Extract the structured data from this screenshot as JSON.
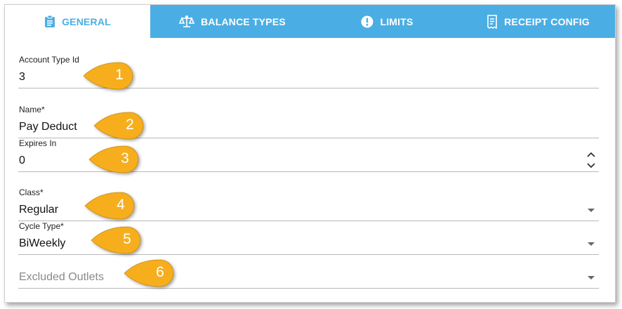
{
  "tabs": [
    {
      "label": "GENERAL",
      "icon": "clipboard-icon",
      "active": true
    },
    {
      "label": "BALANCE TYPES",
      "icon": "scale-icon",
      "active": false
    },
    {
      "label": "LIMITS",
      "icon": "exclamation-circle-icon",
      "active": false
    },
    {
      "label": "RECEIPT CONFIG",
      "icon": "receipt-icon",
      "active": false
    }
  ],
  "fields": {
    "account_type_id": {
      "label": "Account Type Id",
      "value": "3"
    },
    "name": {
      "label": "Name*",
      "value": "Pay Deduct"
    },
    "expires_in": {
      "label": "Expires In",
      "value": "0"
    },
    "class": {
      "label": "Class*",
      "value": "Regular"
    },
    "cycle_type": {
      "label": "Cycle Type*",
      "value": "BiWeekly"
    },
    "excluded_outlets": {
      "placeholder": "Excluded Outlets"
    }
  },
  "callouts": [
    "1",
    "2",
    "3",
    "4",
    "5",
    "6"
  ],
  "colors": {
    "tab_bar": "#4aaee4",
    "active_tab_text": "#4aaee4",
    "callout_fill": "#f6ae1d",
    "underline": "#b8b8b8"
  }
}
